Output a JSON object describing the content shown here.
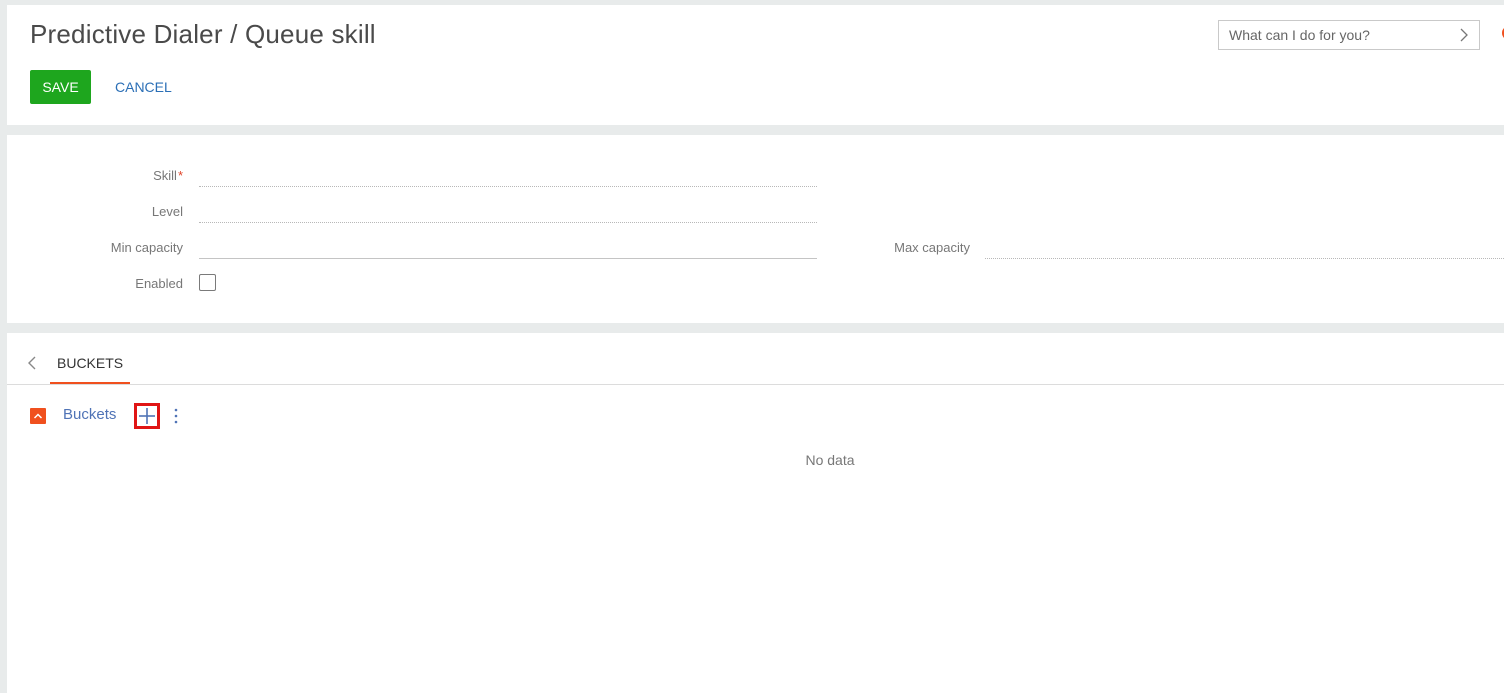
{
  "header": {
    "title": "Predictive Dialer / Queue skill",
    "save_label": "SAVE",
    "cancel_label": "CANCEL",
    "search_placeholder": "What can I do for you?"
  },
  "fields": {
    "skill_label": "Skill",
    "required_marker": "*",
    "level_label": "Level",
    "min_capacity_label": "Min capacity",
    "max_capacity_label": "Max capacity",
    "enabled_label": "Enabled",
    "enabled_checked": false
  },
  "detail": {
    "tab_label": "BUCKETS",
    "title": "Buckets",
    "empty_text": "No data"
  },
  "colors": {
    "save_bg": "#1ea61e",
    "accent_orange": "#f0501e",
    "link_blue": "#2b6fb6",
    "highlight_red": "#e01515"
  },
  "icons": {
    "search_arrow": "chevron-right-icon",
    "tab_back": "chevron-left-icon",
    "collapse": "chevron-up-icon",
    "add": "plus-icon",
    "more": "vertical-dots-icon"
  }
}
